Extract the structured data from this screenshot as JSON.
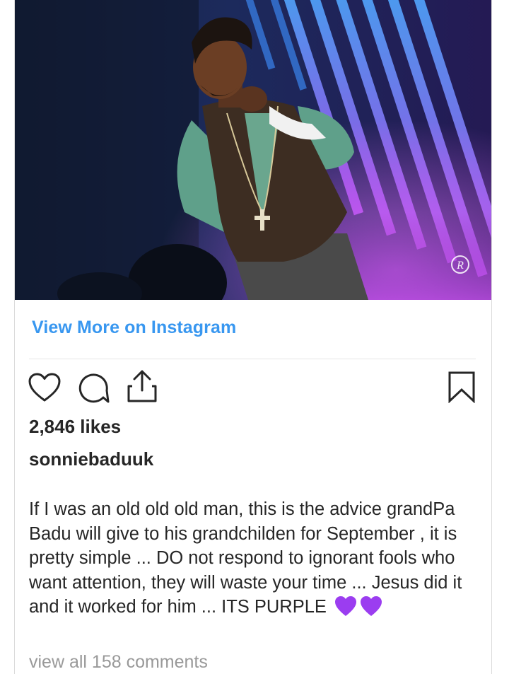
{
  "post": {
    "watermark_letter": "R",
    "view_more_label": "View More on Instagram",
    "likes_text": "2,846 likes",
    "username": "sonniebaduuk",
    "caption_text": "If I was an old old old man, this is the advice grandPa Badu will give to his grandchilden for September , it is pretty simple ... DO not respond to ignorant fools who want attention, they will waste your time ... Jesus did it and it worked for him ... ITS PURPLE ",
    "caption_emojis": [
      "purple-heart-icon",
      "purple-heart-icon"
    ],
    "view_comments_label": "view all 158 comments"
  },
  "actions": {
    "icons": [
      "heart-icon",
      "comment-icon",
      "share-icon",
      "bookmark-icon"
    ]
  },
  "colors": {
    "link": "#3897f0",
    "text": "#262626",
    "muted": "#999999",
    "emoji_purple": "#9b3df0"
  }
}
